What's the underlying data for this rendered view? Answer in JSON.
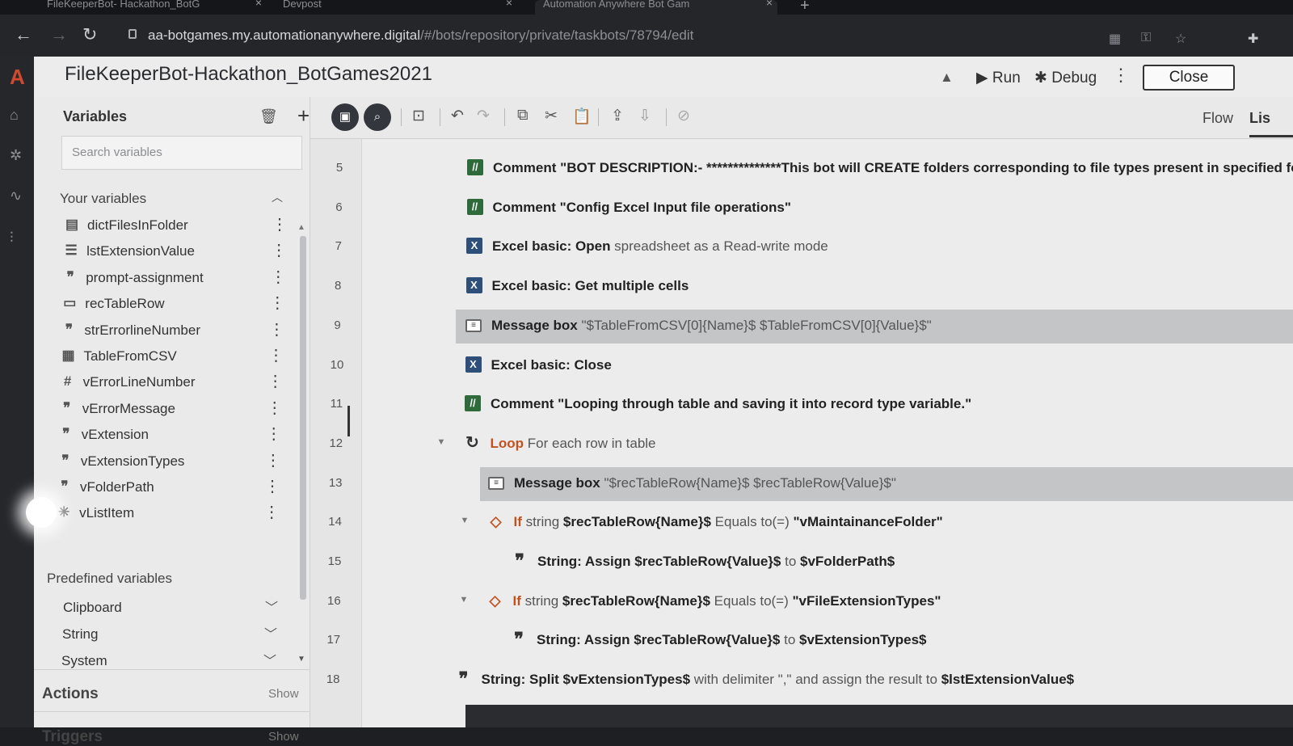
{
  "browser": {
    "tabs": [
      {
        "label": "FileKeeperBot- Hackathon_BotG"
      },
      {
        "label": "Devpost"
      },
      {
        "label": "Automation Anywhere Bot Gam"
      }
    ],
    "url_host": "aa-botgames.my.automationanywhere.digital",
    "url_path": "/#/bots/repository/private/taskbots/78794/edit"
  },
  "header": {
    "title": "FileKeeperBot-Hackathon_BotGames2021",
    "run_label": "Run",
    "debug_label": "Debug",
    "close_label": "Close"
  },
  "variables_panel": {
    "title": "Variables",
    "search_placeholder": "Search variables",
    "your_variables_label": "Your variables",
    "variables": [
      {
        "name": "dictFilesInFolder",
        "icon": "dictionary-icon"
      },
      {
        "name": "lstExtensionValue",
        "icon": "list-icon"
      },
      {
        "name": "prompt-assignment",
        "icon": "string-icon"
      },
      {
        "name": "recTableRow",
        "icon": "record-icon"
      },
      {
        "name": "strErrorlineNumber",
        "icon": "string-icon"
      },
      {
        "name": "TableFromCSV",
        "icon": "table-icon"
      },
      {
        "name": "vErrorLineNumber",
        "icon": "number-icon"
      },
      {
        "name": "vErrorMessage",
        "icon": "string-icon"
      },
      {
        "name": "vExtension",
        "icon": "string-icon"
      },
      {
        "name": "vExtensionTypes",
        "icon": "string-icon"
      },
      {
        "name": "vFolderPath",
        "icon": "string-icon"
      },
      {
        "name": "vListItem",
        "icon": "any-icon"
      }
    ],
    "predefined_label": "Predefined variables",
    "predefined": [
      {
        "name": "Clipboard"
      },
      {
        "name": "String"
      },
      {
        "name": "System"
      }
    ],
    "actions_label": "Actions",
    "triggers_label": "Triggers",
    "show_label": "Show"
  },
  "view_tabs": {
    "flow": "Flow",
    "list": "Lis"
  },
  "code_lines": [
    {
      "n": "5",
      "icon": "comment",
      "indent": 1,
      "parts": [
        {
          "t": "Comment",
          "c": "kw"
        },
        {
          "t": " \"BOT DESCRIPTION:- **************This bot will CREATE folders corresponding to file types present in specified fold",
          "c": "strong"
        }
      ]
    },
    {
      "n": "6",
      "icon": "comment",
      "indent": 1,
      "parts": [
        {
          "t": "Comment",
          "c": "kw"
        },
        {
          "t": " \"Config Excel Input file operations\"",
          "c": "strong"
        }
      ]
    },
    {
      "n": "7",
      "icon": "excel",
      "indent": 1,
      "parts": [
        {
          "t": "Excel basic: Open",
          "c": "kw"
        },
        {
          "t": " spreadsheet as a Read-write mode",
          "c": "sub"
        }
      ]
    },
    {
      "n": "8",
      "icon": "excel",
      "indent": 1,
      "parts": [
        {
          "t": "Excel basic: Get multiple cells",
          "c": "kw"
        }
      ]
    },
    {
      "n": "9",
      "icon": "msg",
      "indent": 1,
      "hl": true,
      "parts": [
        {
          "t": "Message box",
          "c": "kw"
        },
        {
          "t": " \"$TableFromCSV[0]{Name}$ $TableFromCSV[0]{Value}$\"",
          "c": "sub"
        }
      ]
    },
    {
      "n": "10",
      "icon": "excel",
      "indent": 1,
      "parts": [
        {
          "t": "Excel basic: Close",
          "c": "kw"
        }
      ]
    },
    {
      "n": "11",
      "icon": "comment",
      "indent": 1,
      "parts": [
        {
          "t": "Comment",
          "c": "kw"
        },
        {
          "t": " \"Looping through table and saving it into record type variable.\"",
          "c": "strong"
        }
      ]
    },
    {
      "n": "12",
      "icon": "loop",
      "indent": 1,
      "fold": true,
      "parts": [
        {
          "t": "Loop",
          "c": "orange"
        },
        {
          "t": " For each row in table",
          "c": "sub"
        }
      ]
    },
    {
      "n": "13",
      "icon": "msg",
      "indent": 2,
      "hl": true,
      "parts": [
        {
          "t": "Message box",
          "c": "kw"
        },
        {
          "t": " \"$recTableRow{Name}$ $recTableRow{Value}$\"",
          "c": "sub"
        }
      ]
    },
    {
      "n": "14",
      "icon": "if",
      "indent": 2,
      "fold": true,
      "parts": [
        {
          "t": "If",
          "c": "orange"
        },
        {
          "t": " string ",
          "c": "sub"
        },
        {
          "t": "$recTableRow{Name}$",
          "c": "strong"
        },
        {
          "t": " Equals to(=) ",
          "c": "sub"
        },
        {
          "t": "\"vMaintainanceFolder\"",
          "c": "strong"
        }
      ]
    },
    {
      "n": "15",
      "icon": "quote",
      "indent": 3,
      "parts": [
        {
          "t": "String: Assign",
          "c": "kw"
        },
        {
          "t": " $recTableRow{Value}$",
          "c": "strong"
        },
        {
          "t": " to ",
          "c": "sub"
        },
        {
          "t": "$vFolderPath$",
          "c": "strong"
        }
      ]
    },
    {
      "n": "16",
      "icon": "if",
      "indent": 2,
      "fold": true,
      "parts": [
        {
          "t": "If",
          "c": "orange"
        },
        {
          "t": " string ",
          "c": "sub"
        },
        {
          "t": "$recTableRow{Name}$",
          "c": "strong"
        },
        {
          "t": " Equals to(=) ",
          "c": "sub"
        },
        {
          "t": "\"vFileExtensionTypes\"",
          "c": "strong"
        }
      ]
    },
    {
      "n": "17",
      "icon": "quote",
      "indent": 3,
      "parts": [
        {
          "t": "String: Assign",
          "c": "kw"
        },
        {
          "t": " $recTableRow{Value}$",
          "c": "strong"
        },
        {
          "t": " to ",
          "c": "sub"
        },
        {
          "t": "$vExtensionTypes$",
          "c": "strong"
        }
      ]
    },
    {
      "n": "18",
      "icon": "quote",
      "indent": 0,
      "parts": [
        {
          "t": "String: Split",
          "c": "kw"
        },
        {
          "t": " $vExtensionTypes$",
          "c": "strong"
        },
        {
          "t": " with delimiter \",\" and assign the result to ",
          "c": "sub"
        },
        {
          "t": "$lstExtensionValue$",
          "c": "strong"
        }
      ]
    }
  ],
  "colors": {
    "accent_orange": "#c0521f",
    "comment_green": "#2f6b3a",
    "excel_blue": "#2e4f7a"
  }
}
